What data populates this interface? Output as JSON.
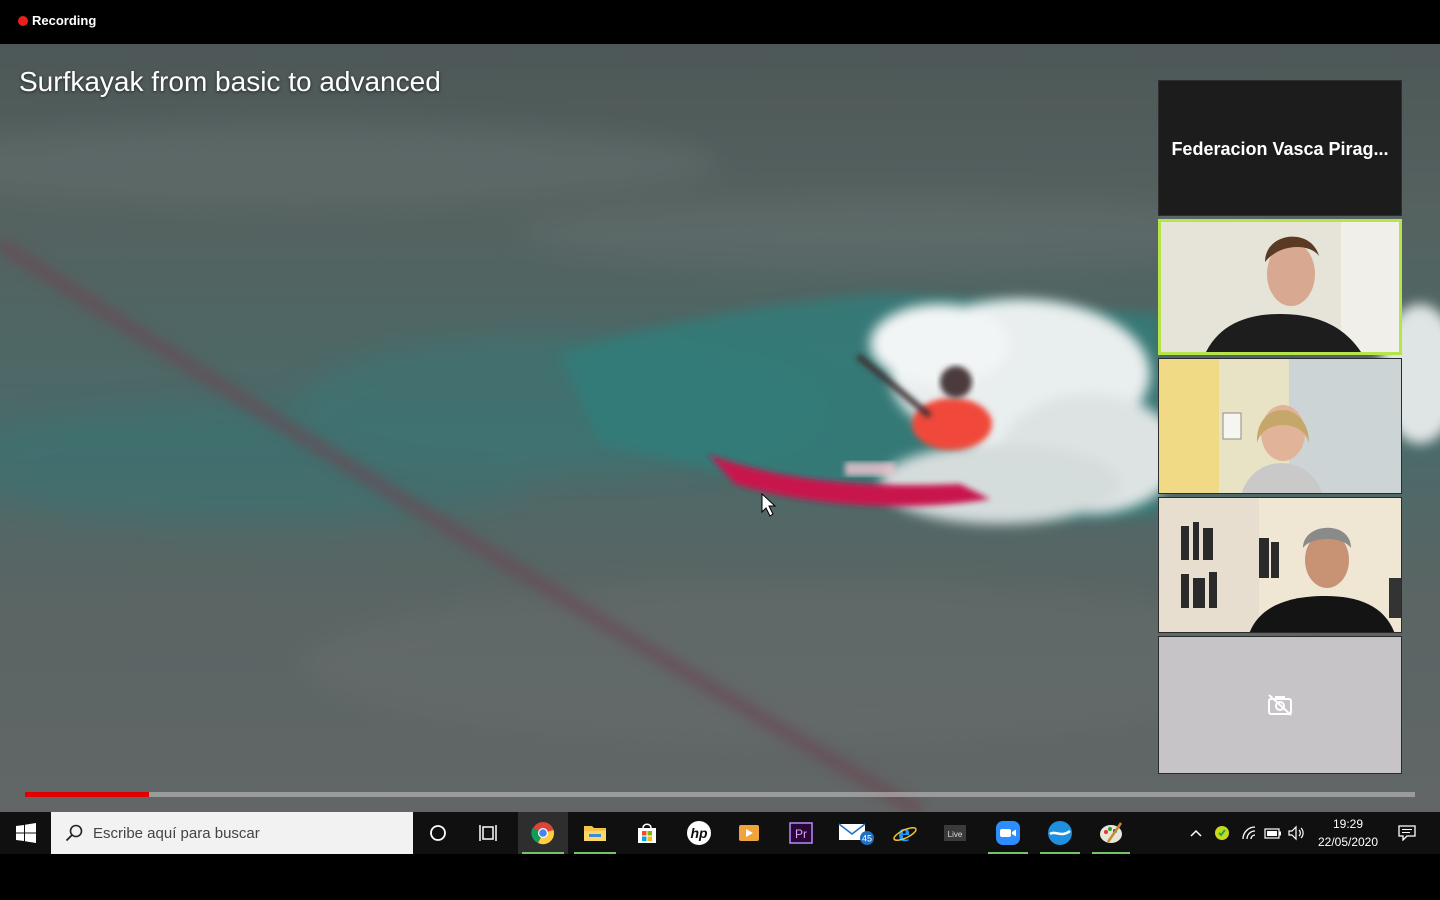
{
  "recording": {
    "label": "Recording",
    "indicator_color": "#e8201a"
  },
  "video": {
    "title": "Surfkayak from basic to advanced",
    "progress_percent": 8.9,
    "progress_color": "#e00000"
  },
  "participants": [
    {
      "type": "name",
      "name": "Federacion Vasca Pirag..."
    },
    {
      "type": "video",
      "speaking": true,
      "highlight_color": "#b7e34b"
    },
    {
      "type": "video",
      "speaking": false
    },
    {
      "type": "video",
      "speaking": false
    },
    {
      "type": "camera-off",
      "icon": "camera-off-icon"
    }
  ],
  "taskbar": {
    "search_placeholder": "Escribe aquí para buscar",
    "apps": [
      {
        "icon": "windows-start-icon"
      },
      {
        "icon": "search-icon"
      },
      {
        "icon": "cortana-icon"
      },
      {
        "icon": "task-view-icon"
      },
      {
        "icon": "chrome-icon",
        "running": true,
        "active": true
      },
      {
        "icon": "file-explorer-icon",
        "running": true
      },
      {
        "icon": "microsoft-store-icon"
      },
      {
        "icon": "hp-icon"
      },
      {
        "icon": "media-player-icon"
      },
      {
        "icon": "premiere-pro-icon",
        "text": "Pr"
      },
      {
        "icon": "mail-icon",
        "badge": "45"
      },
      {
        "icon": "internet-explorer-icon",
        "text": "e"
      },
      {
        "icon": "live-icon",
        "text": "Live"
      },
      {
        "icon": "zoom-icon",
        "running": true
      },
      {
        "icon": "app-blue-icon",
        "running": true
      },
      {
        "icon": "paint-icon",
        "running": true
      }
    ],
    "tray": {
      "icons": [
        "chevron-up-icon",
        "green-shield-icon",
        "wifi-icon",
        "battery-icon",
        "volume-icon",
        "notifications-icon"
      ],
      "time": "19:29",
      "date": "22/05/2020"
    }
  }
}
